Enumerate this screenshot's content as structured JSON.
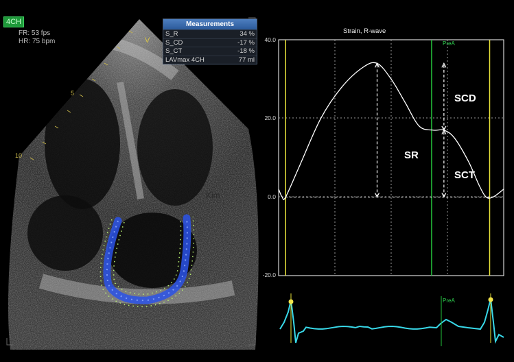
{
  "view_tag": "4CH",
  "acquisition": {
    "fr": "FR: 53 fps",
    "hr": "HR: 75 bpm"
  },
  "depth_marker": "V",
  "depth_ticks": [
    "5",
    "10"
  ],
  "measurements": {
    "title": "Measurements",
    "rows": [
      {
        "label": "S_R",
        "value": "34 %"
      },
      {
        "label": "S_CD",
        "value": "-17 %"
      },
      {
        "label": "S_CT",
        "value": "-18 %"
      },
      {
        "label": "LAVmax 4CH",
        "value": "77 ml"
      }
    ]
  },
  "watermark": "Kim",
  "chart_data": {
    "type": "line",
    "title": "Strain, R-wave",
    "ylim": [
      -20,
      40
    ],
    "yticks": [
      "40.0",
      "20.0",
      "0.0",
      "-20.0"
    ],
    "series": [
      {
        "points": [
          [
            0,
            2
          ],
          [
            1,
            0
          ],
          [
            2,
            0
          ],
          [
            6,
            8
          ],
          [
            12,
            20
          ],
          [
            18,
            28
          ],
          [
            24,
            33
          ],
          [
            28,
            34
          ],
          [
            32,
            30
          ],
          [
            36,
            24
          ],
          [
            40,
            18
          ],
          [
            44,
            17
          ],
          [
            47,
            17
          ],
          [
            50,
            15
          ],
          [
            54,
            9
          ],
          [
            57,
            3
          ],
          [
            59,
            0
          ],
          [
            61,
            0
          ],
          [
            64,
            2
          ]
        ]
      }
    ],
    "annotations": [
      {
        "label": "SR",
        "from": 0,
        "to": 34
      },
      {
        "label": "SCD",
        "from": 17,
        "to": 34
      },
      {
        "label": "SCT",
        "from": 0,
        "to": 17
      }
    ],
    "marker_label": "PreA",
    "ecg_marker_label": "PreA",
    "grid": true
  },
  "colors": {
    "strain_curve": "#ffffff",
    "event_lines": "#e8e23a",
    "prea_line": "#22c03a",
    "ecg": "#38d8e8",
    "trace_overlay": "#2a52e8"
  }
}
